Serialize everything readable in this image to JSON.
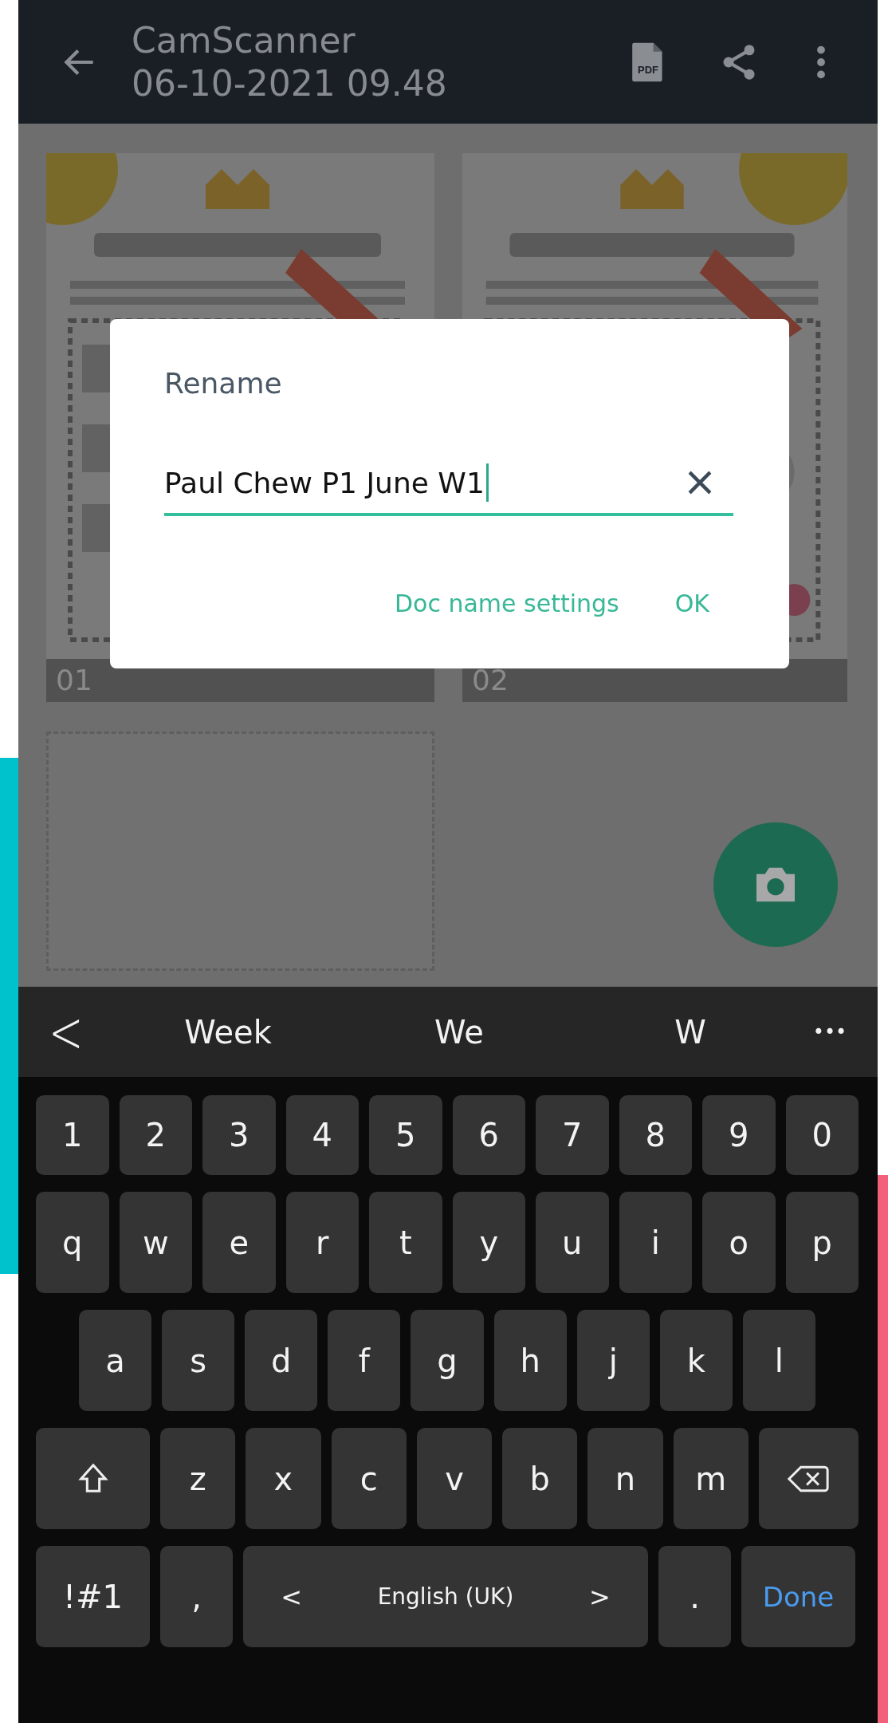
{
  "header": {
    "title": "CamScanner",
    "subtitle": "06-10-2021 09.48",
    "pdf_label": "PDF"
  },
  "pages": [
    {
      "label": "01",
      "kind": "picture"
    },
    {
      "label": "02",
      "kind": "picture"
    }
  ],
  "dialog": {
    "title": "Rename",
    "value": "Paul Chew P1 June W1",
    "buttons": [
      "Doc name settings",
      "OK"
    ]
  },
  "suggestions": {
    "back": "<",
    "words": [
      "Week",
      "We",
      "W"
    ],
    "more": "•••"
  },
  "keyboard": [
    {
      "kind": "digits",
      "keys": [
        {
          "kind": "char",
          "label": "1"
        },
        {
          "kind": "char",
          "label": "2"
        },
        {
          "kind": "char",
          "label": "3"
        },
        {
          "kind": "char",
          "label": "4"
        },
        {
          "kind": "char",
          "label": "5"
        },
        {
          "kind": "char",
          "label": "6"
        },
        {
          "kind": "char",
          "label": "7"
        },
        {
          "kind": "char",
          "label": "8"
        },
        {
          "kind": "char",
          "label": "9"
        },
        {
          "kind": "char",
          "label": "0"
        }
      ]
    },
    {
      "kind": "letters",
      "keys": [
        {
          "kind": "char",
          "label": "q"
        },
        {
          "kind": "char",
          "label": "w"
        },
        {
          "kind": "char",
          "label": "e"
        },
        {
          "kind": "char",
          "label": "r"
        },
        {
          "kind": "char",
          "label": "t"
        },
        {
          "kind": "char",
          "label": "y"
        },
        {
          "kind": "char",
          "label": "u"
        },
        {
          "kind": "char",
          "label": "i"
        },
        {
          "kind": "char",
          "label": "o"
        },
        {
          "kind": "char",
          "label": "p"
        }
      ]
    },
    {
      "kind": "letters-inset",
      "keys": [
        {
          "kind": "char",
          "label": "a"
        },
        {
          "kind": "char",
          "label": "s"
        },
        {
          "kind": "char",
          "label": "d"
        },
        {
          "kind": "char",
          "label": "f"
        },
        {
          "kind": "char",
          "label": "g"
        },
        {
          "kind": "char",
          "label": "h"
        },
        {
          "kind": "char",
          "label": "j"
        },
        {
          "kind": "char",
          "label": "k"
        },
        {
          "kind": "char",
          "label": "l"
        }
      ]
    },
    {
      "kind": "letters",
      "keys": [
        {
          "kind": "shift"
        },
        {
          "kind": "char",
          "label": "z"
        },
        {
          "kind": "char",
          "label": "x"
        },
        {
          "kind": "char",
          "label": "c"
        },
        {
          "kind": "char",
          "label": "v"
        },
        {
          "kind": "char",
          "label": "b"
        },
        {
          "kind": "char",
          "label": "n"
        },
        {
          "kind": "char",
          "label": "m"
        },
        {
          "kind": "backspace"
        }
      ]
    },
    {
      "kind": "letters",
      "keys": [
        {
          "kind": "symbols",
          "label": "!#1"
        },
        {
          "kind": "punct",
          "label": ","
        },
        {
          "kind": "space",
          "label": "English (UK)",
          "left": "<",
          "right": ">"
        },
        {
          "kind": "punct",
          "label": "."
        },
        {
          "kind": "done",
          "label": "Done"
        }
      ]
    }
  ]
}
